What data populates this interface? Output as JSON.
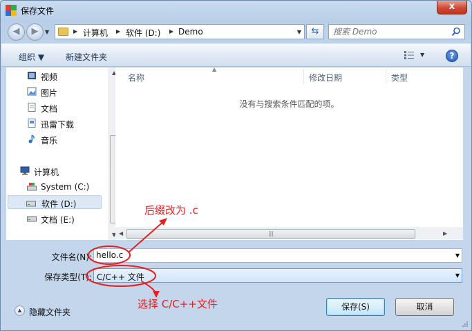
{
  "window": {
    "title": "保存文件",
    "close_label": "x"
  },
  "address": {
    "crumbs": [
      "计算机",
      "软件 (D:)",
      "Demo"
    ],
    "search_placeholder": "搜索 Demo"
  },
  "toolbar": {
    "organize": "组织 ▼",
    "new_folder": "新建文件夹"
  },
  "nav": {
    "items": [
      {
        "label": "视频",
        "icon": "video-icon"
      },
      {
        "label": "图片",
        "icon": "picture-icon"
      },
      {
        "label": "文档",
        "icon": "document-icon"
      },
      {
        "label": "迅雷下载",
        "icon": "download-icon"
      },
      {
        "label": "音乐",
        "icon": "music-icon"
      },
      {
        "label": "计算机",
        "icon": "computer-icon"
      },
      {
        "label": "System (C:)",
        "icon": "system-drive-icon"
      },
      {
        "label": "软件 (D:)",
        "icon": "drive-icon"
      },
      {
        "label": "文档 (E:)",
        "icon": "drive-icon"
      }
    ]
  },
  "list": {
    "columns": [
      "名称",
      "修改日期",
      "类型"
    ],
    "empty_message": "没有与搜索条件匹配的项。"
  },
  "form": {
    "filename_label": "文件名(N):",
    "filename_value": "hello.c",
    "filetype_label": "保存类型(T):",
    "filetype_value": "C/C++ 文件",
    "hide_folders": "隐藏文件夹",
    "save_button": "保存(S)",
    "cancel_button": "取消"
  },
  "annotations": {
    "suffix_note": "后缀改为 .c",
    "type_note": "选择 C/C++文件",
    "color": "#e8201f"
  }
}
